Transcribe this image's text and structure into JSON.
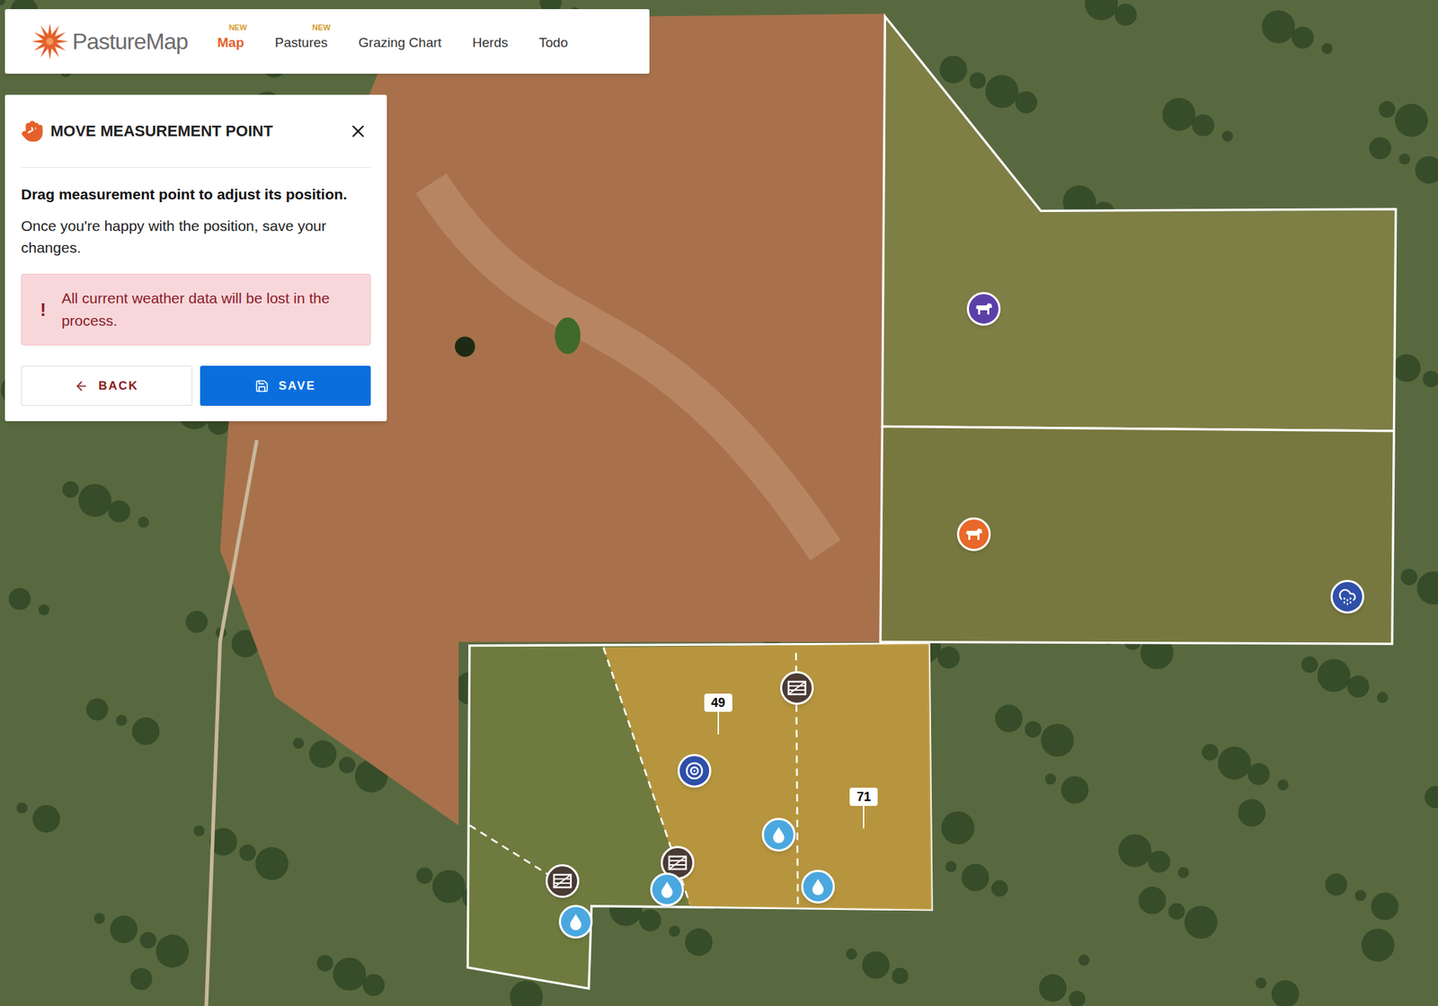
{
  "app": {
    "logo": "PastureMap"
  },
  "nav": [
    {
      "label": "Map",
      "badge": "NEW",
      "selected": true
    },
    {
      "label": "Pastures",
      "badge": "NEW",
      "selected": false
    },
    {
      "label": "Grazing Chart",
      "badge": "",
      "selected": false
    },
    {
      "label": "Herds",
      "badge": "",
      "selected": false
    },
    {
      "label": "Todo",
      "badge": "",
      "selected": false
    }
  ],
  "panel": {
    "title": "MOVE MEASUREMENT POINT",
    "heading": "Drag measurement point to adjust its position.",
    "body": "Once you're happy with the position, save your changes.",
    "alert": {
      "mark": "!",
      "text": "All current weather data will be lost in the process."
    },
    "buttons": [
      {
        "label": "BACK",
        "kind": "secondary"
      },
      {
        "label": "SAVE",
        "kind": "primary"
      }
    ]
  },
  "map": {
    "pins": [
      {
        "kind": "herd",
        "color": "#5b3fa8"
      },
      {
        "kind": "herd",
        "color": "#e8692a"
      },
      {
        "kind": "weather"
      },
      {
        "kind": "gate"
      },
      {
        "kind": "gate"
      },
      {
        "kind": "gate"
      },
      {
        "kind": "target"
      },
      {
        "kind": "water"
      },
      {
        "kind": "water"
      },
      {
        "kind": "water"
      },
      {
        "kind": "water"
      }
    ],
    "labels": [
      {
        "text": "49"
      },
      {
        "text": "71"
      }
    ]
  }
}
